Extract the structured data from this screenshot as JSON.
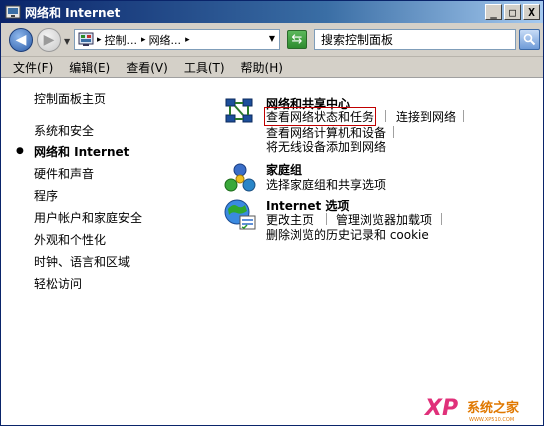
{
  "window": {
    "title": "网络和 Internet",
    "caption_buttons": [
      "_",
      "□",
      "X"
    ]
  },
  "address": {
    "crumbs": [
      "控制...",
      "网络..."
    ],
    "search_text": "搜索控制面板"
  },
  "menu": {
    "items": [
      "文件(F)",
      "编辑(E)",
      "查看(V)",
      "工具(T)",
      "帮助(H)"
    ]
  },
  "sidebar": {
    "home": "控制面板主页",
    "items": [
      "系统和安全",
      "网络和 Internet",
      "硬件和声音",
      "程序",
      "用户帐户和家庭安全",
      "外观和个性化",
      "时钟、语言和区域",
      "轻松访问"
    ],
    "current_index": 1
  },
  "categories": {
    "network_center": {
      "title": "网络和共享中心",
      "tasks": [
        "查看网络状态和任务",
        "连接到网络",
        "查看网络计算机和设备",
        "将无线设备添加到网络"
      ]
    },
    "homegroup": {
      "title": "家庭组",
      "tasks": [
        "选择家庭组和共享选项"
      ]
    },
    "internet_options": {
      "title": "Internet 选项",
      "tasks": [
        "更改主页",
        "管理浏览器加载项",
        "删除浏览的历史记录和 cookie"
      ]
    }
  },
  "watermark": {
    "xp": "XP",
    "text": "系统之家",
    "url": "WWW.XP510.COM"
  },
  "colors": {
    "title_start": "#0a246a",
    "title_end": "#a6caf0",
    "chrome": "#d4d0c8",
    "highlight_border": "#c00000"
  }
}
